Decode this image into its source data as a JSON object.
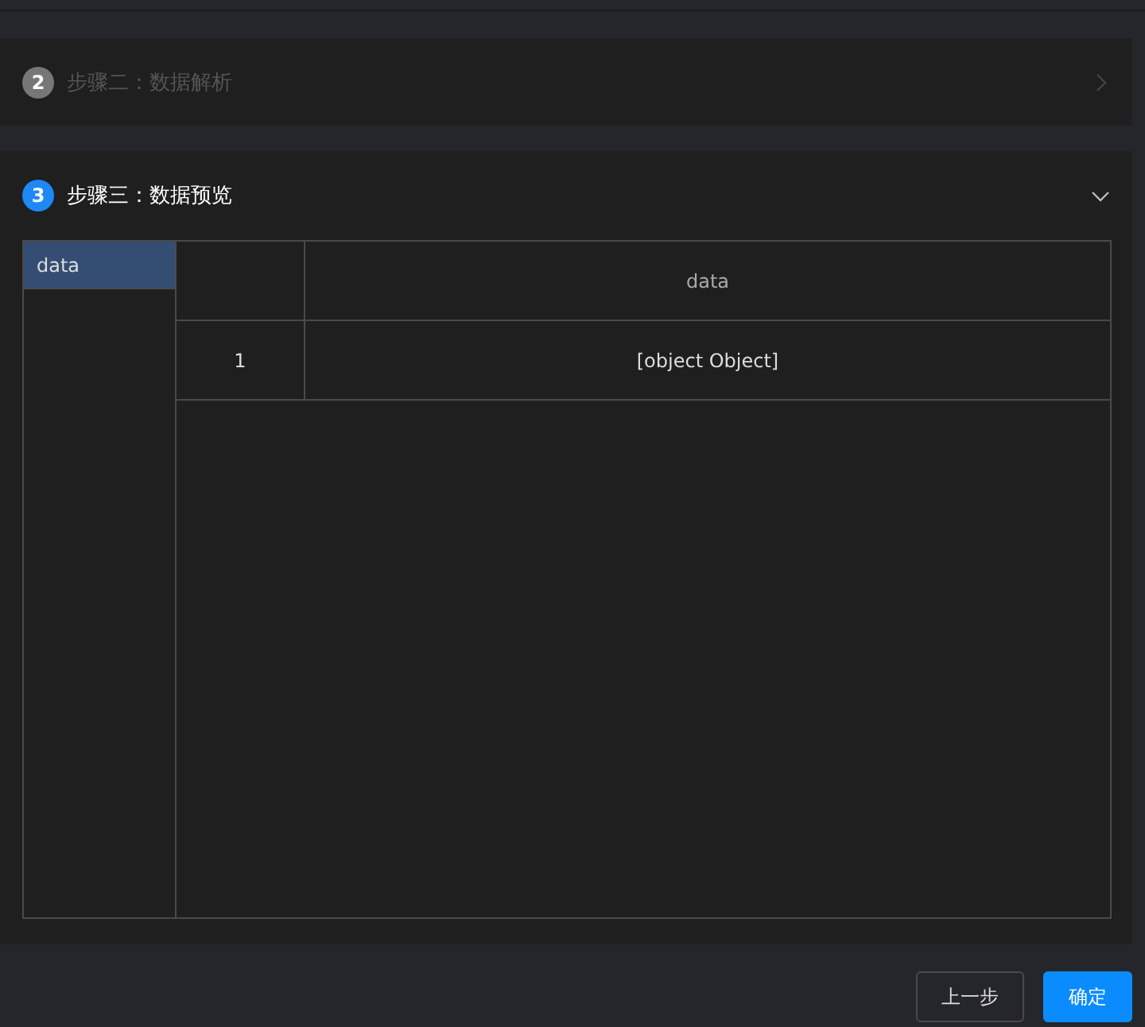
{
  "steps": [
    {
      "number": "2",
      "title": "步骤二：数据解析",
      "active": false,
      "expanded": false
    },
    {
      "number": "3",
      "title": "步骤三：数据预览",
      "active": true,
      "expanded": true,
      "preview": {
        "sources": [
          {
            "label": "data",
            "selected": true
          }
        ],
        "table": {
          "columns": [
            "",
            "data"
          ],
          "rows": [
            [
              "1",
              "[object Object]"
            ]
          ]
        }
      }
    }
  ],
  "buttons": [
    {
      "label": "上一步",
      "kind": "secondary"
    },
    {
      "label": "确定",
      "kind": "primary"
    }
  ]
}
